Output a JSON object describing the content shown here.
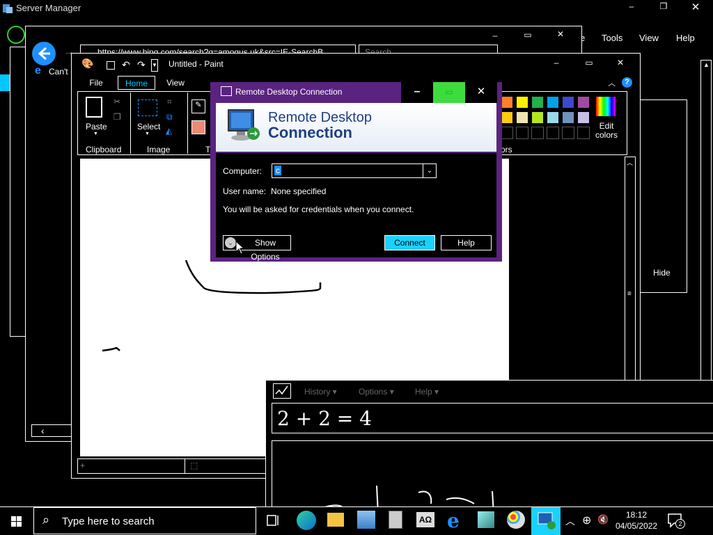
{
  "server_manager": {
    "title": "Server Manager",
    "menu": [
      "Tools",
      "View",
      "Help"
    ]
  },
  "ie_window": {
    "url": "https://www.bing.com/search?q=amogus.uk&src=IE-SearchB...",
    "search_placeholder": "Search",
    "tab_title": "Can't",
    "hide_label": "Hide"
  },
  "paint": {
    "title": "Untitled - Paint",
    "tabs": [
      "File",
      "Home",
      "View"
    ],
    "groups": {
      "clipboard": "Clipboard",
      "image": "Image",
      "tools_short": "T",
      "colors_short": "ors"
    },
    "paste_label": "Paste",
    "select_label": "Select",
    "edit_colors_label": "Edit colors",
    "palette_row1": [
      "#ff7f27",
      "#fff200",
      "#22b14c",
      "#00a2e8",
      "#3f48cc",
      "#a349a4"
    ],
    "palette_row2": [
      "#ffc90e",
      "#efe4b0",
      "#b5e61d",
      "#99d9ea",
      "#7092be",
      "#c8bfe7"
    ]
  },
  "rdc": {
    "title": "Remote Desktop Connection",
    "banner_line1": "Remote Desktop",
    "banner_line2": "Connection",
    "computer_label": "Computer:",
    "computer_value": "c",
    "username_label": "User name:",
    "username_value": "None specified",
    "info": "You will be asked for credentials when you connect.",
    "show_options": "Show Options",
    "connect": "Connect",
    "help": "Help"
  },
  "math_panel": {
    "menu": [
      "History",
      "Options",
      "Help"
    ],
    "expression": "2 + 2 = 4"
  },
  "taskbar": {
    "search_placeholder": "Type here to search",
    "time": "18:12",
    "date": "04/05/2022",
    "notification_count": "2",
    "icons": [
      "task-view-icon",
      "edge-icon",
      "file-explorer-icon",
      "server-manager-icon",
      "calculator-icon",
      "character-map-icon",
      "internet-explorer-icon",
      "math-input-icon",
      "paint-icon",
      "remote-desktop-icon"
    ]
  }
}
